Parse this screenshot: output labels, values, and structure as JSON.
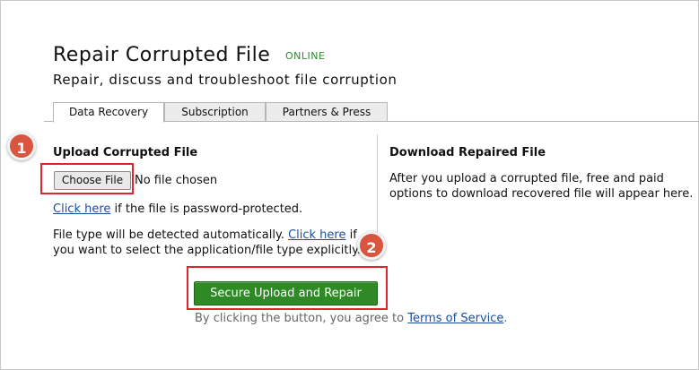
{
  "header": {
    "title": "Repair Corrupted File",
    "badge": "ONLINE",
    "subtitle": "Repair, discuss and troubleshoot file corruption"
  },
  "tabs": [
    {
      "label": "Data Recovery",
      "active": true
    },
    {
      "label": "Subscription",
      "active": false
    },
    {
      "label": "Partners & Press",
      "active": false
    }
  ],
  "upload": {
    "heading": "Upload Corrupted File",
    "choose_button": "Choose File",
    "file_status": "No file chosen",
    "password_link": "Click here",
    "password_text": "if the file is password-protected.",
    "detect_text_1": "File type will be detected automatically.",
    "detect_link": "Click here",
    "detect_text_2": "if",
    "detect_text_3": "you want to select the application/file type explicitly.",
    "submit_button": "Secure Upload and Repair",
    "terms_prefix": "By clicking the button, you agree to",
    "terms_link": "Terms of Service",
    "terms_suffix": "."
  },
  "download": {
    "heading": "Download Repaired File",
    "line_1": "After you upload a corrupted file, free and paid",
    "line_2": "options to download recovered file will appear here."
  },
  "annotations": {
    "step_1": "1",
    "step_2": "2",
    "highlight_color": "#e0262d",
    "badge_color": "#d9553f"
  },
  "colors": {
    "online_badge": "#2e8b2e",
    "submit_button": "#2e8a25",
    "link": "#1a4f9c"
  }
}
